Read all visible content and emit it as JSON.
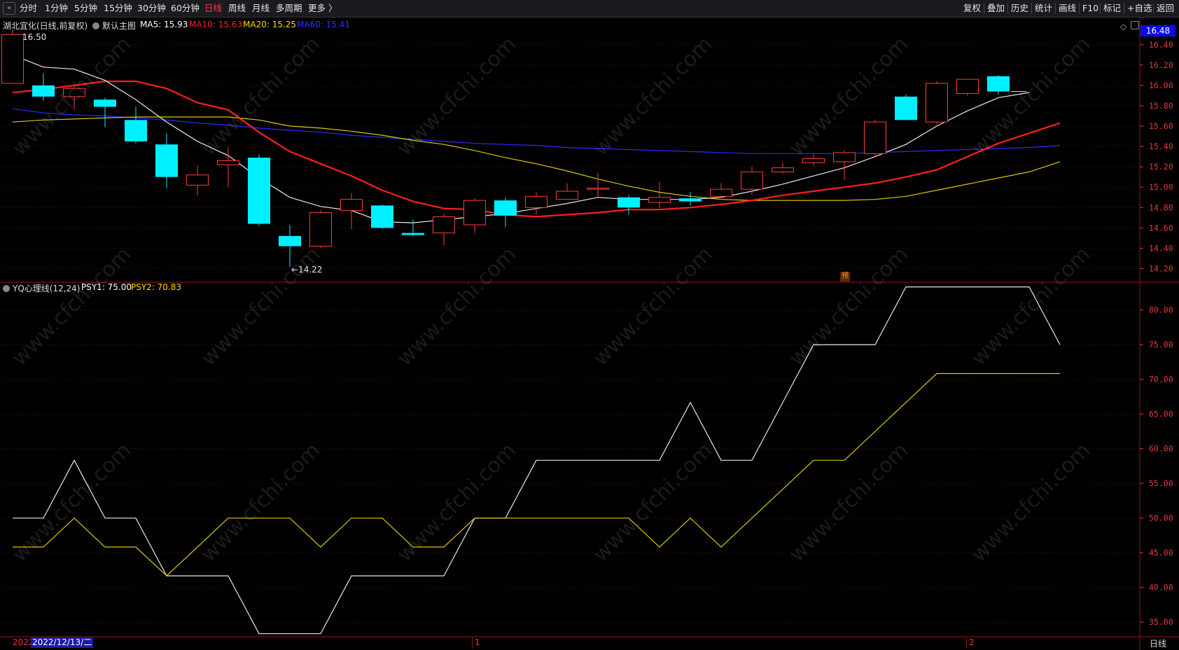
{
  "toolbar": {
    "periods": [
      "分时",
      "1分钟",
      "5分钟",
      "15分钟",
      "30分钟",
      "60分钟",
      "日线",
      "周线",
      "月线",
      "多周期",
      "更多 〉"
    ],
    "active_period": "日线",
    "right_buttons": [
      "复权",
      "叠加",
      "历史",
      "统计",
      "画线",
      "F10",
      "标记",
      "+自选",
      "返回"
    ]
  },
  "main_chart": {
    "stock_label": "湖北宜化(日线,前复权)",
    "indicator_menu": "默认主图",
    "ma_legend": [
      {
        "label": "MA5: 15.93",
        "color": "#ffffff"
      },
      {
        "label": "MA10: 15.63",
        "color": "#ff2020"
      },
      {
        "label": "MA20: 15.25",
        "color": "#ffd700"
      },
      {
        "label": "MA60: 15.41",
        "color": "#3030ff"
      }
    ],
    "high_label": "16.50",
    "low_label": "←14.22",
    "current_price": "16.48",
    "yu_badge": "预",
    "price_axis": [
      "16.40",
      "16.20",
      "16.00",
      "15.80",
      "15.60",
      "15.40",
      "15.20",
      "15.00",
      "14.80",
      "14.60",
      "14.40",
      "14.20"
    ]
  },
  "indicator_chart": {
    "name": "YQ心理线(12,24)",
    "legend": [
      {
        "label": "PSY1: 75.00",
        "color": "#ffffff"
      },
      {
        "label": "PSY2: 70.83",
        "color": "#ffd700"
      }
    ],
    "axis": [
      "80.00",
      "75.00",
      "70.00",
      "65.00",
      "60.00",
      "55.00",
      "50.00",
      "45.00",
      "40.00",
      "35.00"
    ]
  },
  "footer": {
    "date_left": "2022",
    "date_box": "2022/12/13/二",
    "month_marks": [
      "1",
      "2"
    ],
    "period_label": "日线"
  },
  "watermark_text": "www.cfchi.com",
  "chart_data": [
    {
      "type": "candlestick",
      "title": "湖北宜化(日线,前复权)",
      "ylim": [
        14.1,
        16.55
      ],
      "candles": [
        {
          "o": 16.02,
          "c": 16.5,
          "h": 16.55,
          "l": 16.02
        },
        {
          "o": 16.0,
          "c": 15.89,
          "h": 16.12,
          "l": 15.85
        },
        {
          "o": 15.89,
          "c": 15.97,
          "h": 16.0,
          "l": 15.76
        },
        {
          "o": 15.86,
          "c": 15.79,
          "h": 15.88,
          "l": 15.59
        },
        {
          "o": 15.66,
          "c": 15.45,
          "h": 15.79,
          "l": 15.43
        },
        {
          "o": 15.42,
          "c": 15.1,
          "h": 15.53,
          "l": 14.99
        },
        {
          "o": 15.02,
          "c": 15.12,
          "h": 15.21,
          "l": 14.92
        },
        {
          "o": 15.22,
          "c": 15.26,
          "h": 15.39,
          "l": 15.0
        },
        {
          "o": 15.29,
          "c": 14.64,
          "h": 15.32,
          "l": 14.62
        },
        {
          "o": 14.52,
          "c": 14.42,
          "h": 14.63,
          "l": 14.22
        },
        {
          "o": 14.42,
          "c": 14.75,
          "h": 14.77,
          "l": 14.4
        },
        {
          "o": 14.77,
          "c": 14.88,
          "h": 14.94,
          "l": 14.59
        },
        {
          "o": 14.82,
          "c": 14.6,
          "h": 14.83,
          "l": 14.59
        },
        {
          "o": 14.55,
          "c": 14.53,
          "h": 14.68,
          "l": 14.52
        },
        {
          "o": 14.55,
          "c": 14.71,
          "h": 14.74,
          "l": 14.43
        },
        {
          "o": 14.63,
          "c": 14.87,
          "h": 14.89,
          "l": 14.55
        },
        {
          "o": 14.87,
          "c": 14.72,
          "h": 14.9,
          "l": 14.61
        },
        {
          "o": 14.8,
          "c": 14.91,
          "h": 14.95,
          "l": 14.73
        },
        {
          "o": 14.88,
          "c": 14.96,
          "h": 15.04,
          "l": 14.88
        },
        {
          "o": 14.99,
          "c": 14.99,
          "h": 15.14,
          "l": 14.9
        },
        {
          "o": 14.9,
          "c": 14.8,
          "h": 14.92,
          "l": 14.73
        },
        {
          "o": 14.85,
          "c": 14.9,
          "h": 15.05,
          "l": 14.8
        },
        {
          "o": 14.89,
          "c": 14.86,
          "h": 14.95,
          "l": 14.82
        },
        {
          "o": 14.91,
          "c": 14.98,
          "h": 15.04,
          "l": 14.9
        },
        {
          "o": 14.98,
          "c": 15.15,
          "h": 15.2,
          "l": 14.93
        },
        {
          "o": 15.15,
          "c": 15.19,
          "h": 15.24,
          "l": 15.13
        },
        {
          "o": 15.24,
          "c": 15.28,
          "h": 15.33,
          "l": 15.21
        },
        {
          "o": 15.25,
          "c": 15.34,
          "h": 15.36,
          "l": 15.07
        },
        {
          "o": 15.33,
          "c": 15.64,
          "h": 15.66,
          "l": 15.3
        },
        {
          "o": 15.89,
          "c": 15.66,
          "h": 15.91,
          "l": 15.66
        },
        {
          "o": 15.64,
          "c": 16.02,
          "h": 16.04,
          "l": 15.62
        },
        {
          "o": 15.92,
          "c": 16.06,
          "h": 16.06,
          "l": 15.9
        },
        {
          "o": 16.09,
          "c": 15.94,
          "h": 16.1,
          "l": 15.91
        }
      ],
      "ma5": [
        16.3,
        16.18,
        16.16,
        16.05,
        15.86,
        15.64,
        15.45,
        15.31,
        15.09,
        14.9,
        14.81,
        14.77,
        14.66,
        14.65,
        14.68,
        14.71,
        14.74,
        14.79,
        14.84,
        14.9,
        14.88,
        14.88,
        14.88,
        14.9,
        14.96,
        15.03,
        15.11,
        15.19,
        15.3,
        15.42,
        15.6,
        15.75,
        15.88,
        15.93
      ],
      "ma10": [
        15.93,
        15.96,
        16.0,
        16.04,
        16.04,
        15.97,
        15.83,
        15.76,
        15.54,
        15.35,
        15.23,
        15.11,
        14.97,
        14.86,
        14.79,
        14.78,
        14.73,
        14.71,
        14.73,
        14.75,
        14.78,
        14.78,
        14.8,
        14.83,
        14.87,
        14.92,
        14.96,
        15.0,
        15.04,
        15.1,
        15.17,
        15.3,
        15.43,
        15.53,
        15.63
      ],
      "ma20": [
        15.64,
        15.66,
        15.67,
        15.68,
        15.69,
        15.69,
        15.69,
        15.69,
        15.66,
        15.6,
        15.58,
        15.55,
        15.51,
        15.46,
        15.42,
        15.36,
        15.29,
        15.23,
        15.16,
        15.08,
        15.01,
        14.95,
        14.91,
        14.88,
        14.87,
        14.87,
        14.87,
        14.87,
        14.88,
        14.91,
        14.97,
        15.03,
        15.09,
        15.15,
        15.25
      ],
      "ma60": [
        15.77,
        15.73,
        15.71,
        15.7,
        15.68,
        15.66,
        15.63,
        15.61,
        15.58,
        15.56,
        15.54,
        15.51,
        15.49,
        15.47,
        15.45,
        15.43,
        15.42,
        15.41,
        15.39,
        15.38,
        15.37,
        15.36,
        15.35,
        15.34,
        15.33,
        15.33,
        15.33,
        15.33,
        15.34,
        15.35,
        15.36,
        15.37,
        15.38,
        15.39,
        15.41
      ]
    },
    {
      "type": "line",
      "title": "YQ心理线(12,24)",
      "ylim": [
        33,
        84
      ],
      "series": [
        {
          "name": "PSY1",
          "values": [
            50.0,
            50.0,
            58.33,
            50.0,
            50.0,
            41.67,
            41.67,
            41.67,
            33.33,
            33.33,
            33.33,
            41.67,
            41.67,
            41.67,
            41.67,
            50.0,
            50.0,
            58.33,
            58.33,
            58.33,
            58.33,
            58.33,
            66.67,
            58.33,
            58.33,
            66.67,
            75.0,
            75.0,
            75.0,
            83.33,
            83.33,
            83.33,
            83.33,
            83.33,
            75.0
          ]
        },
        {
          "name": "PSY2",
          "values": [
            45.83,
            45.83,
            50.0,
            45.83,
            45.83,
            41.67,
            45.83,
            50.0,
            50.0,
            50.0,
            45.83,
            50.0,
            50.0,
            45.83,
            45.83,
            50.0,
            50.0,
            50.0,
            50.0,
            50.0,
            50.0,
            45.83,
            50.0,
            45.83,
            50.0,
            54.17,
            58.33,
            58.33,
            62.5,
            66.67,
            70.83,
            70.83,
            70.83,
            70.83,
            70.83
          ]
        }
      ]
    }
  ]
}
